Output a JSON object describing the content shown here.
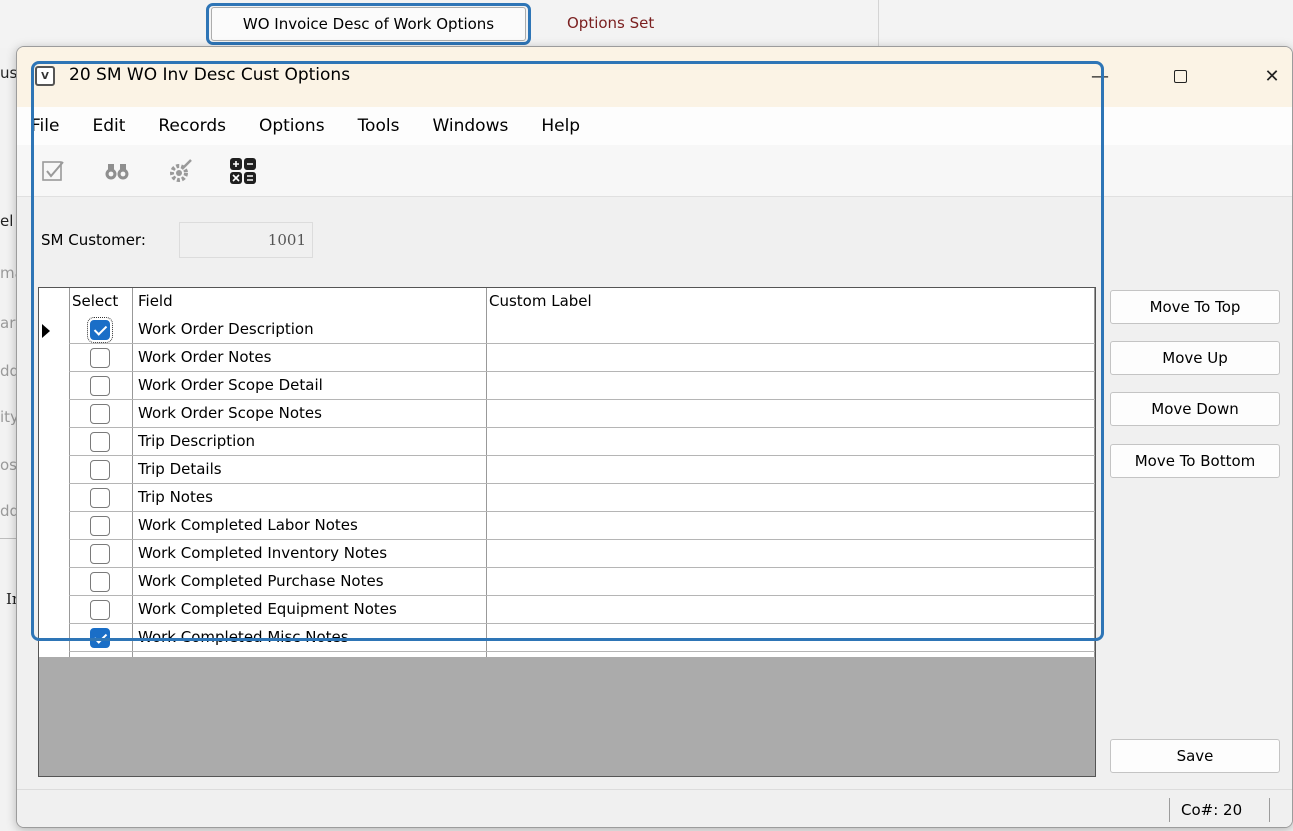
{
  "background": {
    "tab_button_label": "WO Invoice Desc of Work Options",
    "status_text": "Options Set",
    "left_fragments": [
      "us",
      "el",
      "ma",
      "ar",
      "dd",
      "ity",
      "os",
      "dd",
      "In"
    ]
  },
  "window": {
    "title": "20 SM WO Inv Desc Cust Options",
    "controls": {
      "minimize": "—",
      "close": "✕"
    }
  },
  "menu": [
    "File",
    "Edit",
    "Records",
    "Options",
    "Tools",
    "Windows",
    "Help"
  ],
  "toolbar": [
    "edit-check-icon",
    "binoculars-icon",
    "gear-tools-icon",
    "calculator-icon"
  ],
  "customer": {
    "label": "SM Customer:",
    "value": "1001"
  },
  "grid": {
    "headers": {
      "select": "Select",
      "field": "Field",
      "custom_label": "Custom Label"
    },
    "rows": [
      {
        "field": "Work Order Description",
        "selected": true
      },
      {
        "field": "Work Order Notes",
        "selected": false
      },
      {
        "field": "Work Order Scope Detail",
        "selected": false
      },
      {
        "field": "Work Order Scope Notes",
        "selected": false
      },
      {
        "field": "Trip Description",
        "selected": false
      },
      {
        "field": "Trip Details",
        "selected": false
      },
      {
        "field": "Trip Notes",
        "selected": false
      },
      {
        "field": "Work Completed Labor Notes",
        "selected": false
      },
      {
        "field": "Work Completed Inventory Notes",
        "selected": false
      },
      {
        "field": "Work Completed Purchase Notes",
        "selected": false
      },
      {
        "field": "Work Completed Equipment Notes",
        "selected": false
      },
      {
        "field": "Work Completed Misc Notes",
        "selected": true
      }
    ]
  },
  "buttons": {
    "move_top": "Move To Top",
    "move_up": "Move Up",
    "move_down": "Move Down",
    "move_bottom": "Move To Bottom",
    "save": "Save"
  },
  "status": {
    "company": "Co#: 20"
  },
  "colors": {
    "highlight": "#2e75b6",
    "check": "#1a6ec7",
    "titlebar": "#fbf3e5"
  }
}
